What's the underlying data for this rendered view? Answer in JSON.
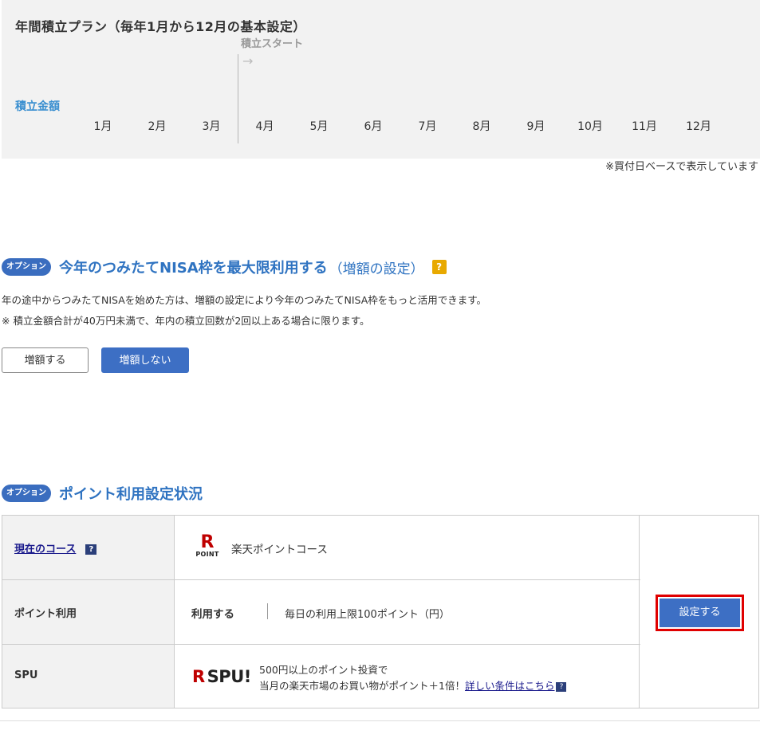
{
  "plan": {
    "title": "年間積立プラン（毎年1月から12月の基本設定）",
    "start_label": "積立スタート",
    "start_arrow": "→",
    "amount_label": "積立金額",
    "months": [
      "1月",
      "2月",
      "3月",
      "4月",
      "5月",
      "6月",
      "7月",
      "8月",
      "9月",
      "10月",
      "11月",
      "12月"
    ],
    "note": "※買付日ベースで表示しています"
  },
  "nisa_option": {
    "badge": "オプション",
    "title": "今年のつみたてNISA枠を最大限利用する",
    "subtitle": "（増額の設定）",
    "help": "?",
    "desc1": "年の途中からつみたてNISAを始めた方は、増額の設定により今年のつみたてNISA枠をもっと活用できます。",
    "desc2": "※  積立金額合計が40万円未満で、年内の積立回数が2回以上ある場合に限ります。",
    "btn_increase": "増額する",
    "btn_no_increase": "増額しない"
  },
  "point_option": {
    "badge": "オプション",
    "title": "ポイント利用設定状況",
    "rows": {
      "course_label": "現在のコース",
      "course_help": "?",
      "course_logo_r": "R",
      "course_logo_text": "POINT",
      "course_value": "楽天ポイントコース",
      "use_label": "ポイント利用",
      "use_value": "利用する",
      "use_limit": "毎日の利用上限100ポイント（円）",
      "spu_label": "SPU",
      "spu_logo_r": "R",
      "spu_logo_text": "SPU!",
      "spu_line1": "500円以上のポイント投資で",
      "spu_line2": "当月の楽天市場のお買い物がポイント＋1倍！",
      "spu_link": "詳しい条件はこちら",
      "spu_help": "?"
    },
    "settings_button": "設定する"
  },
  "colors": {
    "accent_blue": "#3d6fc4",
    "heading_blue": "#2f73c1",
    "highlight_red": "#e00000",
    "rakuten_red": "#bf0000",
    "help_yellow": "#e8a900"
  }
}
